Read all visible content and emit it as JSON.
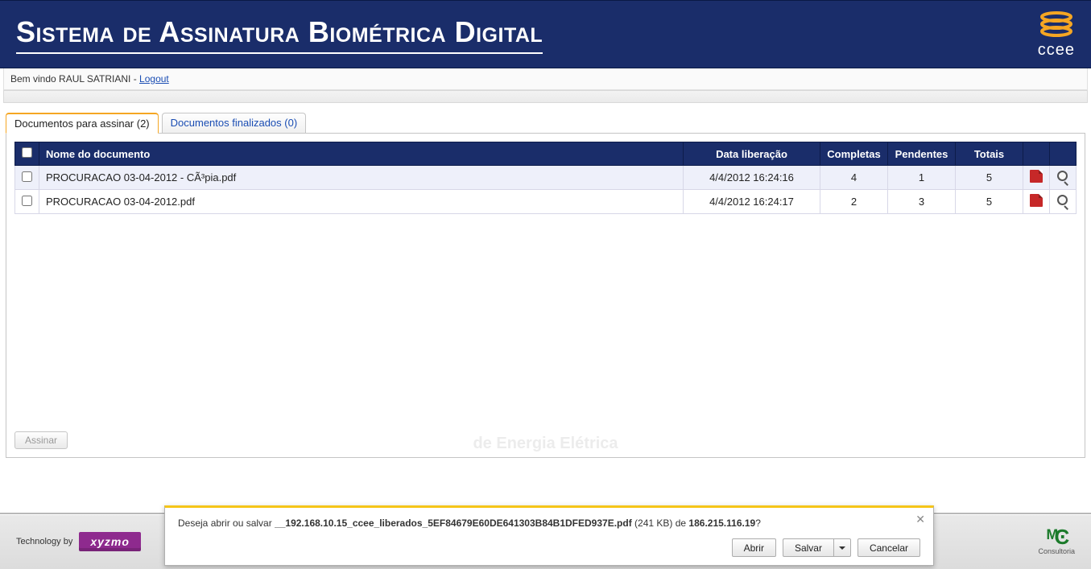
{
  "header": {
    "title": "Sistema de Assinatura Biométrica Digital",
    "logo_text": "ccee"
  },
  "userbar": {
    "greeting": "Bem vindo RAUL SATRIANI - ",
    "logout": "Logout"
  },
  "tabs": {
    "sign": "Documentos para assinar (2)",
    "done": "Documentos finalizados (0)"
  },
  "table": {
    "headers": {
      "name": "Nome do documento",
      "date": "Data liberação",
      "complete": "Completas",
      "pending": "Pendentes",
      "total": "Totais"
    },
    "rows": [
      {
        "name": "PROCURACAO 03-04-2012 - CÃ³pia.pdf",
        "date": "4/4/2012 16:24:16",
        "complete": "4",
        "pending": "1",
        "total": "5"
      },
      {
        "name": "PROCURACAO 03-04-2012.pdf",
        "date": "4/4/2012 16:24:17",
        "complete": "2",
        "pending": "3",
        "total": "5"
      }
    ]
  },
  "buttons": {
    "assinar": "Assinar",
    "abrir": "Abrir",
    "salvar": "Salvar",
    "cancelar": "Cancelar"
  },
  "watermark": "de Energia Elétrica",
  "footer": {
    "tech": "Technology by",
    "xyzmo": "xyzmo",
    "mc": "Consultoria"
  },
  "download": {
    "prefix": "Deseja abrir ou salvar ",
    "file": "__192.168.10.15_ccee_liberados_5EF84679E60DE641303B84B1DFED937E.pdf",
    "size": " (241 KB) de ",
    "host": "186.215.116.19",
    "q": "?"
  }
}
